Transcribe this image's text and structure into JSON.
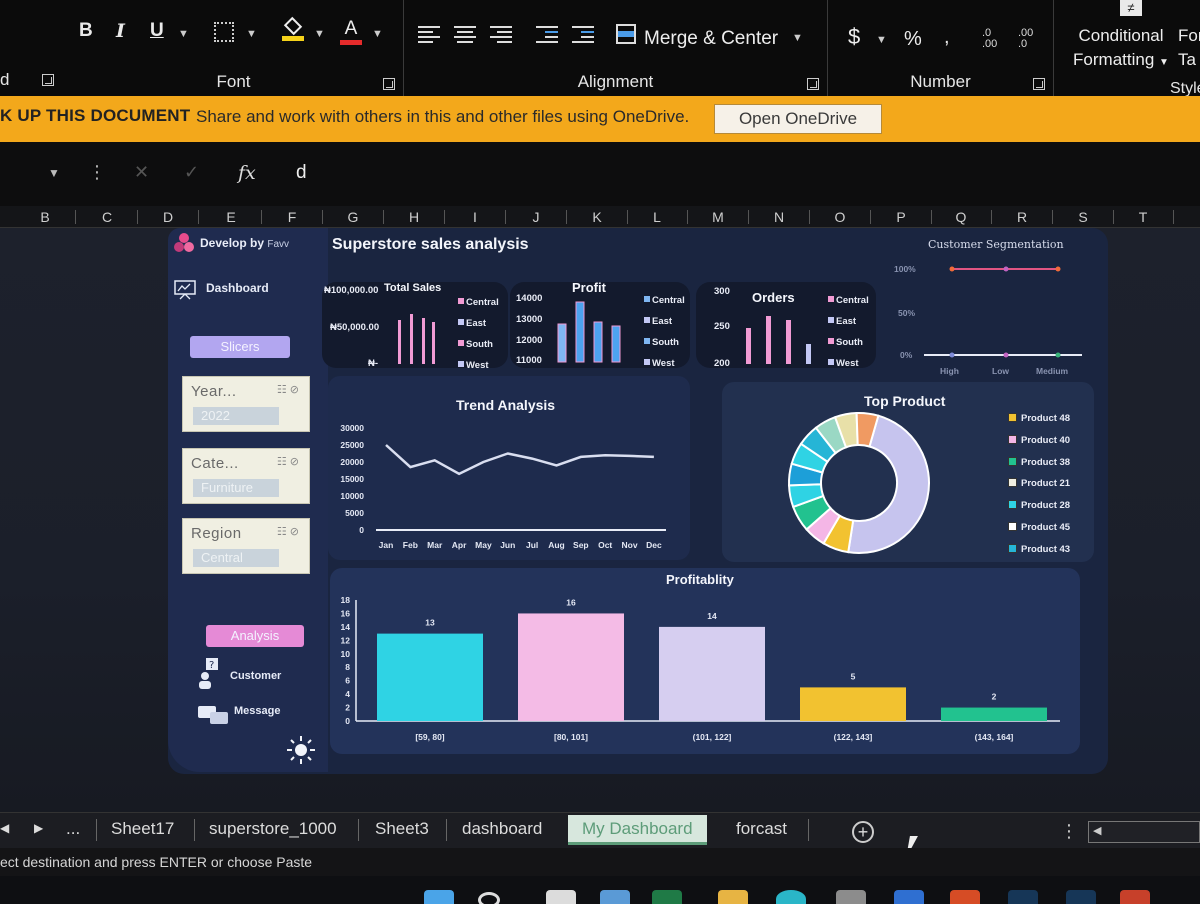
{
  "ribbon": {
    "bold_label": "B",
    "italic_label": "I",
    "underline_label": "U",
    "font_group_label": "Font",
    "alignment_group_label": "Alignment",
    "merge_center_label": "Merge & Center",
    "number_group_label": "Number",
    "currency_symbol": "$",
    "percent_symbol": "%",
    "comma_symbol": ",",
    "conditional_formatting_line1": "Conditional",
    "conditional_formatting_line2": "Formatting",
    "format_table_label": "For",
    "format_table_label2": "Ta",
    "styles_group_label": "Style",
    "left_cut_label": "d"
  },
  "banner": {
    "title": "K UP THIS DOCUMENT",
    "message": "Share and work with others in this and other files using OneDrive.",
    "button": "Open OneDrive"
  },
  "formula_bar": {
    "fx": "fx",
    "value": "d"
  },
  "columns": [
    "B",
    "C",
    "D",
    "E",
    "F",
    "G",
    "H",
    "I",
    "J",
    "K",
    "L",
    "M",
    "N",
    "O",
    "P",
    "Q",
    "R",
    "S",
    "T"
  ],
  "dashboard": {
    "brand": "Develop by",
    "brand_suffix": "Favv",
    "title": "Superstore sales analysis",
    "nav": {
      "dashboard": "Dashboard",
      "slicers": "Slicers",
      "analysis": "Analysis",
      "customer": "Customer",
      "message": "Message"
    },
    "slicers": [
      {
        "title": "Year...",
        "value": "2022"
      },
      {
        "title": "Cate...",
        "value": "Furniture"
      },
      {
        "title": "Region",
        "value": "Central"
      }
    ],
    "kpis": {
      "sales": {
        "title": "Total Sales",
        "axis": [
          "₦100,000.00",
          "₦50,000.00",
          "₦-"
        ],
        "legend": [
          "Central",
          "East",
          "South",
          "West"
        ]
      },
      "profit": {
        "title": "Profit",
        "axis": [
          "14000",
          "13000",
          "12000",
          "11000"
        ],
        "legend": [
          "Central",
          "East",
          "South",
          "West"
        ]
      },
      "orders": {
        "title": "Orders",
        "axis": [
          "300",
          "250",
          "200"
        ],
        "legend": [
          "Central",
          "East",
          "South",
          "West"
        ]
      },
      "segmentation": {
        "title": "Customer Segmentation",
        "axis": [
          "100%",
          "50%",
          "0%"
        ],
        "categories": [
          "High",
          "Low",
          "Medium"
        ]
      }
    },
    "colors": {
      "pink": "#f19bd4",
      "lavender": "#c3c8f5",
      "cyan": "#2fd3e4",
      "yellow": "#f2c230",
      "teal": "#22c28f"
    }
  },
  "chart_data": [
    {
      "type": "line",
      "title": "Trend Analysis",
      "categories": [
        "Jan",
        "Feb",
        "Mar",
        "Apr",
        "May",
        "Jun",
        "Jul",
        "Aug",
        "Sep",
        "Oct",
        "Nov",
        "Dec"
      ],
      "values": [
        25000,
        18500,
        20500,
        16500,
        20000,
        22500,
        21000,
        19000,
        21500,
        22000,
        21800,
        21500
      ],
      "ylim": [
        0,
        30000
      ],
      "yticks": [
        0,
        5000,
        10000,
        15000,
        20000,
        25000,
        30000
      ]
    },
    {
      "type": "pie",
      "title": "Top Product",
      "legend": [
        "Product 48",
        "Product 40",
        "Product 38",
        "Product 21",
        "Product 28",
        "Product 45",
        "Product 43"
      ],
      "values": [
        48,
        6,
        5,
        6,
        5,
        5,
        5,
        5,
        5,
        5,
        5
      ]
    },
    {
      "type": "bar",
      "title": "Profitablity",
      "categories": [
        "[59, 80]",
        "[80, 101]",
        "(101, 122]",
        "(122, 143]",
        "(143, 164]"
      ],
      "values": [
        13,
        16,
        14,
        5,
        2
      ],
      "ylim": [
        0,
        18
      ],
      "yticks": [
        0,
        2,
        4,
        6,
        8,
        10,
        12,
        14,
        16,
        18
      ],
      "data_labels": [
        "13",
        "16",
        "14",
        "5",
        "2"
      ]
    }
  ],
  "sheet_tabs": [
    "...",
    "Sheet17",
    "superstore_1000",
    "Sheet3",
    "dashboard",
    "My Dashboard",
    "forcast"
  ],
  "status": "ect destination and press ENTER or choose Paste"
}
